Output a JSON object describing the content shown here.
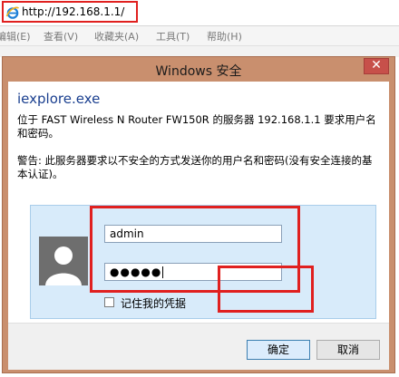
{
  "browser": {
    "url": "http://192.168.1.1/",
    "menu": [
      "编辑(E)",
      "查看(V)",
      "收藏夹(A)",
      "工具(T)",
      "帮助(H)"
    ]
  },
  "dialog": {
    "title": "Windows 安全",
    "close_glyph": "✕",
    "app_name": "iexplore.exe",
    "message": "位于 FAST Wireless N Router FW150R 的服务器 192.168.1.1 要求用户名和密码。",
    "warning": "警告: 此服务器要求以不安全的方式发送你的用户名和密码(没有安全连接的基本认证)。",
    "username_value": "admin",
    "password_mask": "●●●●●",
    "remember_label": "记住我的凭据",
    "ok_label": "确定",
    "cancel_label": "取消"
  },
  "colors": {
    "highlight_red": "#e0201f",
    "dialog_frame": "#c98f6e",
    "credential_panel": "#d8ebfa",
    "app_name_blue": "#1a3f8f"
  },
  "icons": {
    "browser": "ie-icon",
    "avatar": "user-avatar-icon",
    "close": "close-icon"
  }
}
